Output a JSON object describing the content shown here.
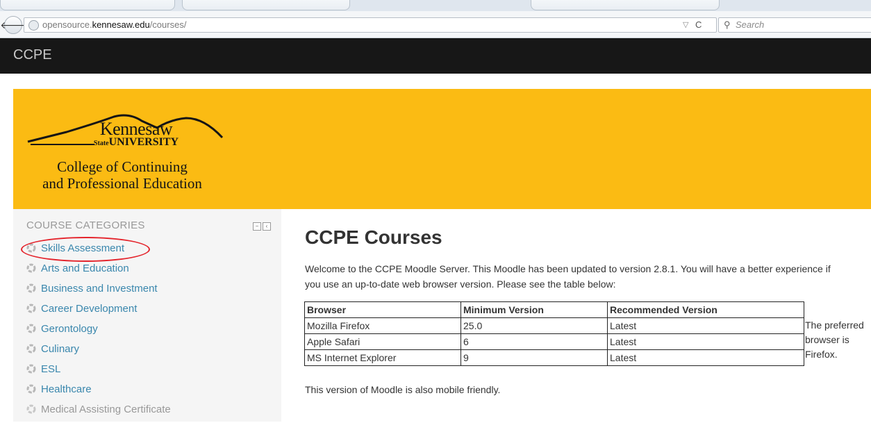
{
  "browser": {
    "url_prefix": "opensource.",
    "url_domain": "kennesaw.edu",
    "url_path": "/courses/",
    "back_glyph": "🡐",
    "dropmark_glyph": "▽",
    "reload_glyph": "C",
    "search_glyph": "⚲",
    "search_placeholder": "Search",
    "icons": [
      "back-arrow-icon",
      "globe-icon",
      "dropdown-icon",
      "reload-icon",
      "search-icon"
    ]
  },
  "site": {
    "brand": "CCPE"
  },
  "logo": {
    "line1": "Kennesaw",
    "line2_small": "State",
    "line2": "UNIVERSITY",
    "line3": "College of Continuing",
    "line4": "and Professional Education"
  },
  "block": {
    "title": "COURSE CATEGORIES",
    "controls": [
      "−",
      "‹"
    ],
    "categories": [
      {
        "label": "Skills Assessment",
        "highlighted": true
      },
      {
        "label": "Arts and Education"
      },
      {
        "label": "Business and Investment"
      },
      {
        "label": "Career Development"
      },
      {
        "label": "Gerontology"
      },
      {
        "label": "Culinary"
      },
      {
        "label": "ESL"
      },
      {
        "label": "Healthcare"
      },
      {
        "label": "Medical Assisting Certificate",
        "dimmed": true
      }
    ]
  },
  "main": {
    "title": "CCPE Courses",
    "intro": "Welcome to the CCPE Moodle Server. This Moodle has been updated to version 2.8.1. You will have a better experience if you use an up-to-date web browser version. Please see the table below:",
    "table": {
      "headers": [
        "Browser",
        "Minimum Version",
        "Recommended Version"
      ],
      "rows": [
        [
          "Mozilla Firefox",
          "25.0",
          "Latest"
        ],
        [
          "Apple Safari",
          "6",
          "Latest"
        ],
        [
          "MS Internet Explorer",
          "9",
          "Latest"
        ]
      ]
    },
    "preferred_note": "The preferred browser is Firefox.",
    "footnote": "This version of Moodle is also mobile friendly."
  },
  "colors": {
    "banner": "#fbbb13",
    "sitebar": "#171717",
    "link": "#3a87ad",
    "highlight_ring": "#e4242c"
  }
}
